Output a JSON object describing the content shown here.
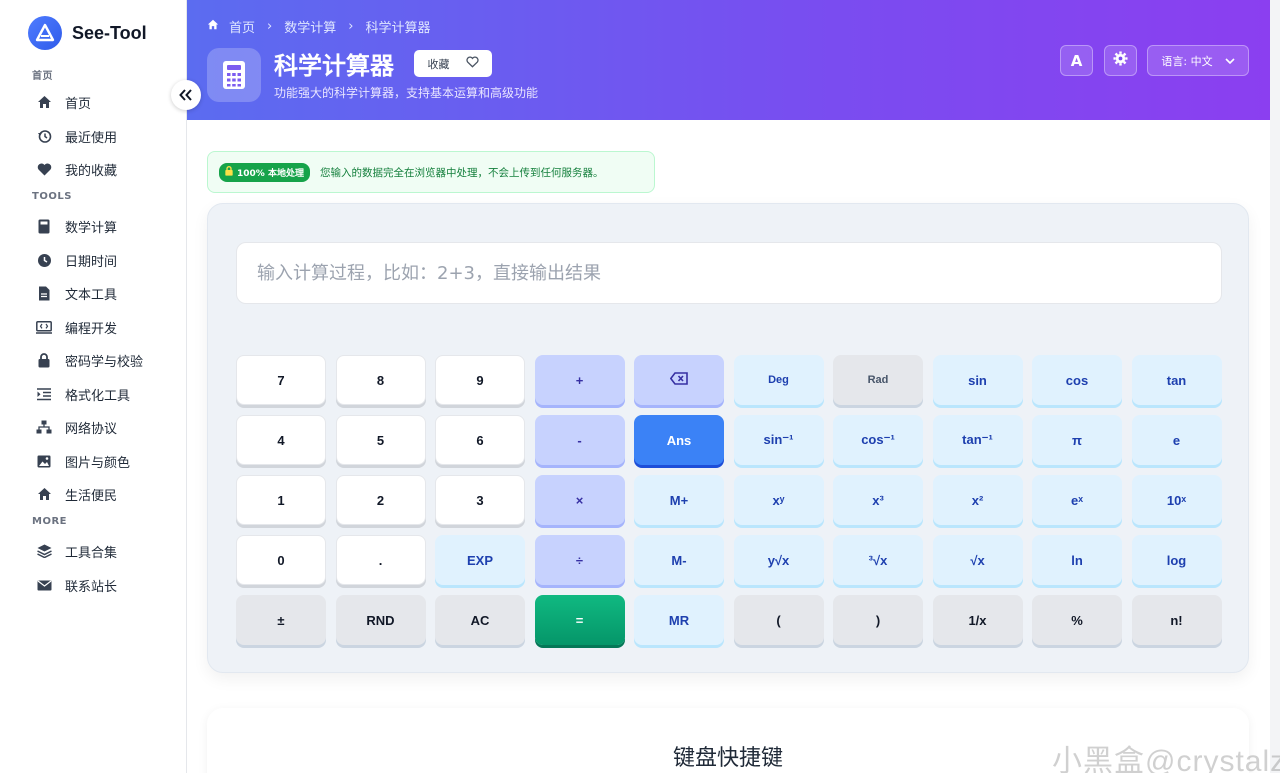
{
  "brand": {
    "name": "See-Tool"
  },
  "sidebar": {
    "sections": [
      {
        "label": "首页",
        "items": [
          {
            "label": "首页",
            "icon": "home-icon"
          },
          {
            "label": "最近使用",
            "icon": "history-icon"
          },
          {
            "label": "我的收藏",
            "icon": "heart-icon"
          }
        ]
      },
      {
        "label": "TOOLS",
        "items": [
          {
            "label": "数学计算",
            "icon": "calculator-icon"
          },
          {
            "label": "日期时间",
            "icon": "clock-icon"
          },
          {
            "label": "文本工具",
            "icon": "file-text-icon"
          },
          {
            "label": "编程开发",
            "icon": "code-icon"
          },
          {
            "label": "密码学与校验",
            "icon": "lock-icon"
          },
          {
            "label": "格式化工具",
            "icon": "indent-icon"
          },
          {
            "label": "网络协议",
            "icon": "network-icon"
          },
          {
            "label": "图片与颜色",
            "icon": "image-icon"
          },
          {
            "label": "生活便民",
            "icon": "home-icon"
          }
        ]
      },
      {
        "label": "MORE",
        "items": [
          {
            "label": "工具合集",
            "icon": "layers-icon"
          },
          {
            "label": "联系站长",
            "icon": "mail-icon"
          }
        ]
      }
    ]
  },
  "header": {
    "breadcrumbs": [
      "首页",
      "数学计算",
      "科学计算器"
    ],
    "title": "科学计算器",
    "favorite_label": "收藏",
    "subtitle": "功能强大的科学计算器，支持基本运算和高级功能",
    "font_button": "A",
    "language_label": "语言: 中文"
  },
  "notice": {
    "badge": "100% 本地处理",
    "text": "您输入的数据完全在浏览器中处理，不会上传到任何服务器。"
  },
  "calculator": {
    "placeholder": "输入计算过程，比如：2+3，直接输出结果",
    "keys": [
      [
        "7",
        "8",
        "9",
        "+",
        "⌫",
        "Deg",
        "Rad",
        "sin",
        "cos",
        "tan"
      ],
      [
        "4",
        "5",
        "6",
        "-",
        "Ans",
        "sin⁻¹",
        "cos⁻¹",
        "tan⁻¹",
        "π",
        "e"
      ],
      [
        "1",
        "2",
        "3",
        "×",
        "M+",
        "xʸ",
        "x³",
        "x²",
        "eˣ",
        "10ˣ"
      ],
      [
        "0",
        ".",
        "EXP",
        "÷",
        "M-",
        "y√x",
        "³√x",
        "√x",
        "ln",
        "log"
      ],
      [
        "±",
        "RND",
        "AC",
        "=",
        "MR",
        "(",
        ")",
        "1/x",
        "%",
        "n!"
      ]
    ]
  },
  "shortcuts": {
    "title": "键盘快捷键"
  },
  "watermark": "小黑盒@crystalz"
}
